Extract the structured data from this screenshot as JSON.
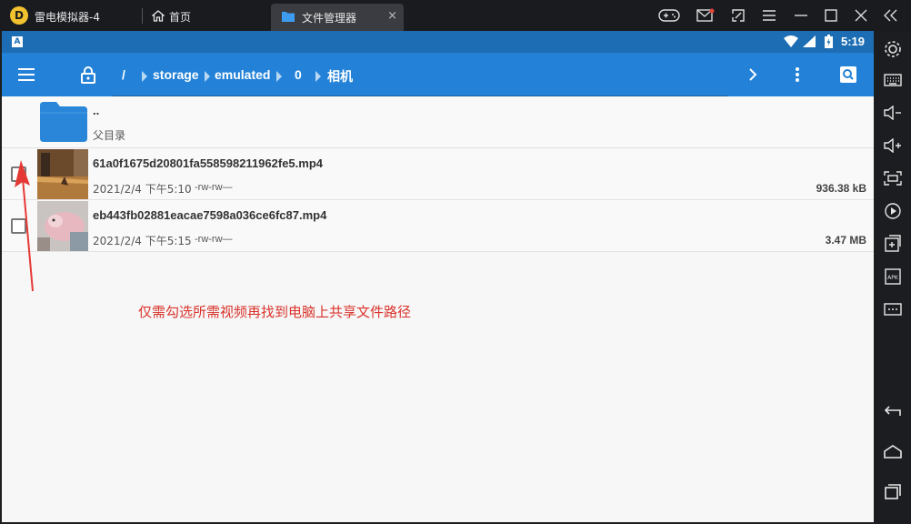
{
  "titlebar": {
    "app_name": "雷电模拟器-4",
    "home_tab": "首页",
    "fm_tab": "文件管理器",
    "close_glyph": "×"
  },
  "statusbar": {
    "time": "5:19",
    "keyboard_indicator": "A"
  },
  "toolbar": {
    "breadcrumbs": [
      "/",
      "storage",
      "emulated",
      "0",
      "相机"
    ]
  },
  "files": [
    {
      "name": "..",
      "sub": "父目录",
      "type": "parent"
    },
    {
      "name": "61a0f1675d20801fa558598211962fe5.mp4",
      "date": "2021/2/4 下午5:10",
      "perm": "-rw-rw—",
      "size": "936.38 kB",
      "type": "video"
    },
    {
      "name": "eb443fb02881eacae7598a036ce6fc87.mp4",
      "date": "2021/2/4 下午5:15",
      "perm": "-rw-rw—",
      "size": "3.47 MB",
      "type": "video"
    }
  ],
  "annotation": "仅需勾选所需视频再找到电脑上共享文件路径",
  "colors": {
    "toolbar": "#2382d8",
    "statusbar": "#1c6db4",
    "folder": "#2a86d8",
    "annotation": "#d9332b"
  },
  "sidebar_icons": [
    "gear-icon",
    "keyboard-icon",
    "volume-down-icon",
    "volume-up-icon",
    "screenshot-icon",
    "record-icon",
    "add-icon",
    "apk-icon",
    "more-icon",
    "back-icon",
    "home-icon",
    "recents-icon"
  ]
}
